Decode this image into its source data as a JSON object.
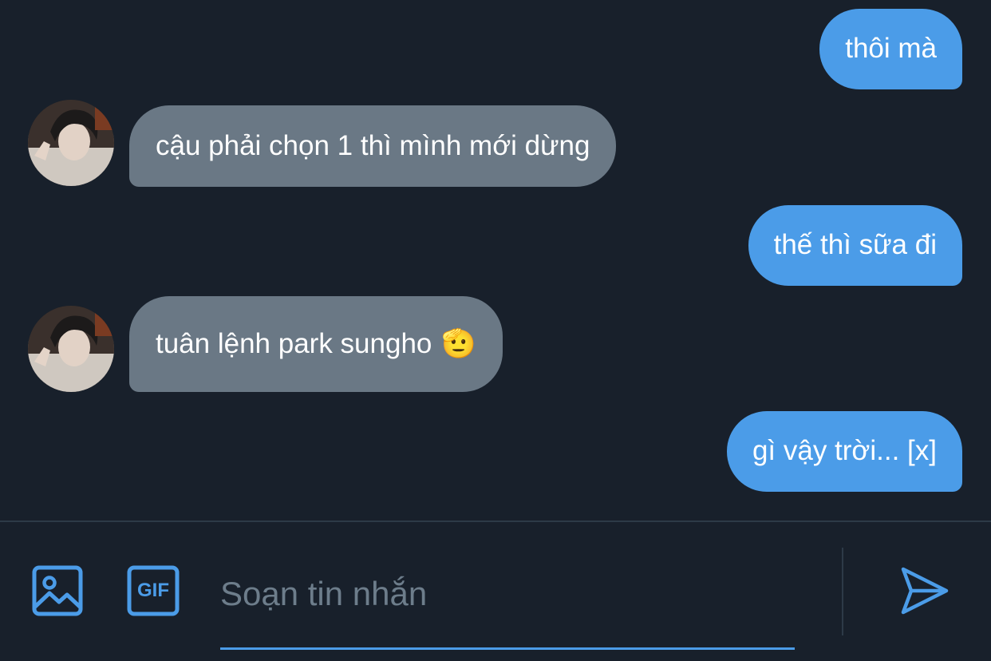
{
  "messages": [
    {
      "direction": "outgoing",
      "text": "thôi mà"
    },
    {
      "direction": "incoming",
      "text": "cậu phải chọn 1 thì mình mới dừng",
      "avatar": "avatar"
    },
    {
      "direction": "outgoing",
      "text": "thế thì sữa đi"
    },
    {
      "direction": "incoming",
      "text": "tuân lệnh park sungho",
      "emoji": "🫡",
      "avatar": "avatar"
    },
    {
      "direction": "outgoing",
      "text": "gì vậy trời... [x]"
    }
  ],
  "composer": {
    "placeholder": "Soạn tin nhắn",
    "value": "",
    "image_button_icon": "image-icon",
    "gif_button_icon": "gif-icon",
    "gif_label": "GIF",
    "send_button_icon": "send-icon"
  },
  "colors": {
    "background": "#18202b",
    "outgoing_bubble": "#4b9ce8",
    "incoming_bubble": "#6a7885",
    "accent": "#4b9ce8",
    "placeholder": "#6d7d8b"
  }
}
